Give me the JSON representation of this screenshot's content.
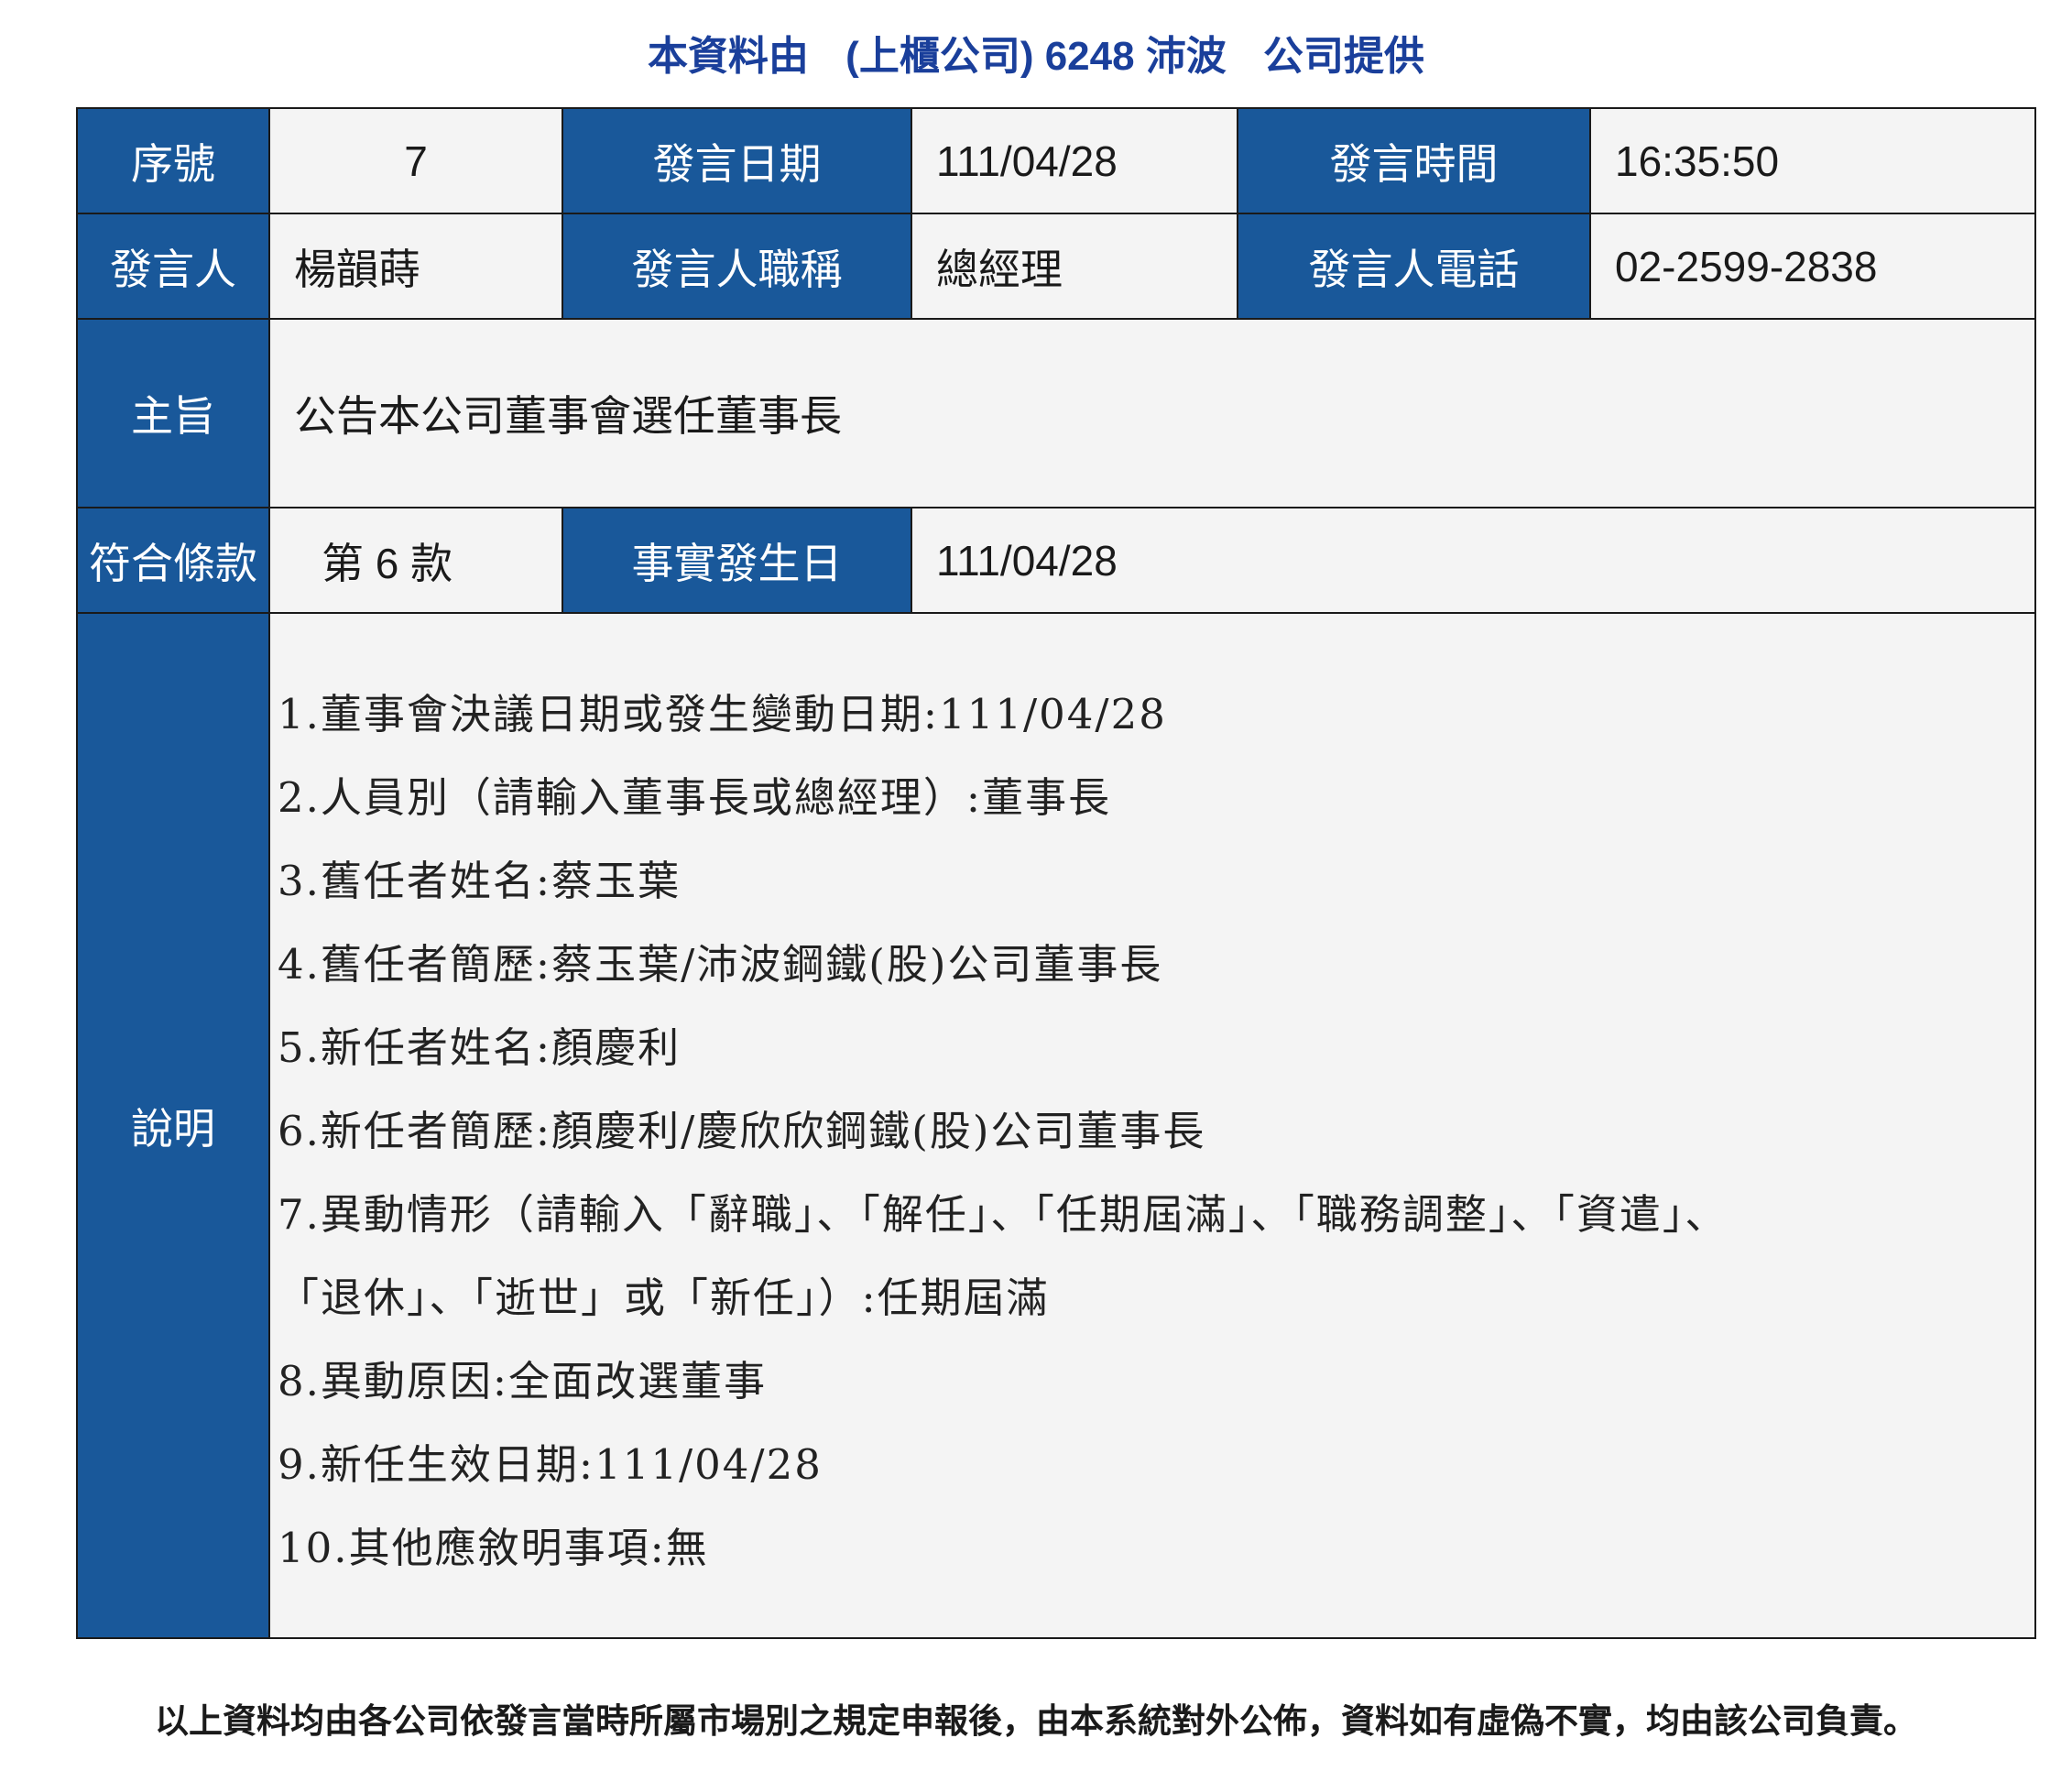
{
  "header": {
    "part1": "本資料由",
    "part2": "(上櫃公司) 6248 沛波",
    "part3": "公司提供"
  },
  "table": {
    "seq_label": "序號",
    "seq_value": "7",
    "date_label": "發言日期",
    "date_value": "111/04/28",
    "time_label": "發言時間",
    "time_value": "16:35:50",
    "speaker_label": "發言人",
    "speaker_value": "楊韻蒔",
    "title_label": "發言人職稱",
    "title_value": "總經理",
    "phone_label": "發言人電話",
    "phone_value": "02-2599-2838",
    "subject_label": "主旨",
    "subject_value": "公告本公司董事會選任董事長",
    "clause_label": "符合條款",
    "clause_value": "第 6 款",
    "fact_date_label": "事實發生日",
    "fact_date_value": "111/04/28",
    "desc_label": "說明",
    "desc_lines": [
      "1.董事會決議日期或發生變動日期:111/04/28",
      "2.人員別（請輸入董事長或總經理）:董事長",
      "3.舊任者姓名:蔡玉葉",
      "4.舊任者簡歷:蔡玉葉/沛波鋼鐵(股)公司董事長",
      "5.新任者姓名:顏慶利",
      "6.新任者簡歷:顏慶利/慶欣欣鋼鐵(股)公司董事長",
      "7.異動情形（請輸入「辭職」、「解任」、「任期屆滿」、「職務調整」、「資遣」、",
      "「退休」、「逝世」或「新任」）:任期屆滿",
      "8.異動原因:全面改選董事",
      "9.新任生效日期:111/04/28",
      "10.其他應敘明事項:無"
    ]
  },
  "footer": {
    "text": "以上資料均由各公司依發言當時所屬市場別之規定申報後，由本系統對外公佈，資料如有虛偽不實，均由該公司負責。"
  },
  "colors": {
    "label_bg": "#19589a",
    "value_bg": "#f4f4f4",
    "header_text": "#1a3f9b"
  }
}
